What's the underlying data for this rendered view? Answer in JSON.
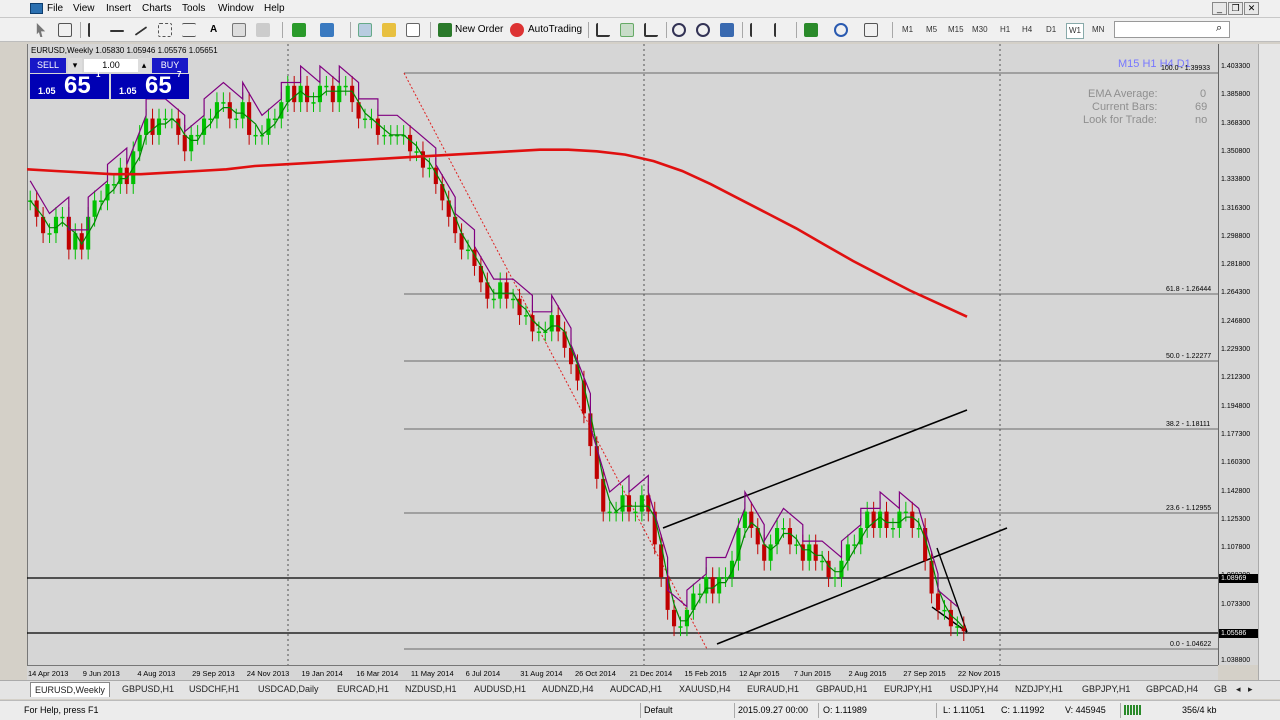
{
  "menu": {
    "items": [
      "File",
      "View",
      "Insert",
      "Charts",
      "Tools",
      "Window",
      "Help"
    ]
  },
  "toolbar": {
    "new_order": "New Order",
    "autotrading": "AutoTrading",
    "timeframes": [
      "M1",
      "M5",
      "M15",
      "M30",
      "H1",
      "H4",
      "D1",
      "W1",
      "MN"
    ],
    "active_timeframe": "W1"
  },
  "chart": {
    "symbol_header": "EURUSD,Weekly 1.05830 1.05946 1.05576 1.05651",
    "trade_panel": {
      "sell_label": "SELL",
      "buy_label": "BUY",
      "lot": "1.00",
      "sell_small": "1.05",
      "sell_big": "65",
      "sell_sup": "1",
      "buy_small": "1.05",
      "buy_big": "65",
      "buy_sup": "7"
    },
    "timeframe_row": "M15 H1 H4 D1",
    "ema_panel": [
      {
        "label": "EMA Average:",
        "value": "0"
      },
      {
        "label": "Current Bars:",
        "value": "69"
      },
      {
        "label": "Look for Trade:",
        "value": "no"
      }
    ],
    "fib_levels": [
      "100.0 - 1.39933",
      "61.8 - 1.26444",
      "50.0 - 1.22277",
      "38.2 - 1.18111",
      "23.6 - 1.12955",
      "0.0 - 1.04622"
    ],
    "price_labels": [
      "1.403300",
      "1.385800",
      "1.368300",
      "1.350800",
      "1.333800",
      "1.316300",
      "1.298800",
      "1.281800",
      "1.264300",
      "1.246800",
      "1.229300",
      "1.212300",
      "1.194800",
      "1.177300",
      "1.160300",
      "1.142800",
      "1.125300",
      "1.107800",
      "1.090300",
      "1.073300",
      "1.055800",
      "1.038800"
    ],
    "price_hline1": "1.08969",
    "price_hline2": "1.05586",
    "time_labels": [
      "14 Apr 2013",
      "9 Jun 2013",
      "4 Aug 2013",
      "29 Sep 2013",
      "24 Nov 2013",
      "19 Jan 2014",
      "16 Mar 2014",
      "11 May 2014",
      "6 Jul 2014",
      "31 Aug 2014",
      "26 Oct 2014",
      "21 Dec 2014",
      "15 Feb 2015",
      "12 Apr 2015",
      "7 Jun 2015",
      "2 Aug 2015",
      "27 Sep 2015",
      "22 Nov 2015"
    ],
    "chart_data": {
      "type": "candlestick",
      "series": [
        {
          "name": "EMA",
          "color": "#e01010"
        },
        {
          "name": "signal",
          "color": "#800080"
        }
      ],
      "ylim": [
        1.0388,
        1.4033
      ],
      "ema": [
        1.339,
        1.338,
        1.337,
        1.336,
        1.336,
        1.337,
        1.338,
        1.339,
        1.341,
        1.342,
        1.343,
        1.344,
        1.345,
        1.346,
        1.347,
        1.348,
        1.349,
        1.35,
        1.351,
        1.351,
        1.35,
        1.348,
        1.344,
        1.338,
        1.33,
        1.321,
        1.312,
        1.303,
        1.293,
        1.283,
        1.274,
        1.265,
        1.257,
        1.249
      ],
      "close": [
        1.32,
        1.31,
        1.3,
        1.3,
        1.31,
        1.31,
        1.29,
        1.3,
        1.29,
        1.31,
        1.32,
        1.32,
        1.33,
        1.33,
        1.34,
        1.33,
        1.35,
        1.36,
        1.37,
        1.36,
        1.37,
        1.37,
        1.37,
        1.36,
        1.35,
        1.36,
        1.36,
        1.37,
        1.37,
        1.38,
        1.38,
        1.37,
        1.37,
        1.38,
        1.36,
        1.36,
        1.36,
        1.37,
        1.37,
        1.38,
        1.39,
        1.38,
        1.39,
        1.38,
        1.38,
        1.39,
        1.39,
        1.38,
        1.39,
        1.39,
        1.38,
        1.37,
        1.37,
        1.37,
        1.36,
        1.36,
        1.36,
        1.36,
        1.36,
        1.35,
        1.35,
        1.34,
        1.34,
        1.33,
        1.32,
        1.31,
        1.3,
        1.29,
        1.29,
        1.28,
        1.27,
        1.26,
        1.26,
        1.27,
        1.26,
        1.26,
        1.25,
        1.25,
        1.24,
        1.24,
        1.24,
        1.25,
        1.24,
        1.23,
        1.22,
        1.21,
        1.19,
        1.17,
        1.15,
        1.13,
        1.13,
        1.13,
        1.14,
        1.13,
        1.13,
        1.14,
        1.13,
        1.11,
        1.09,
        1.07,
        1.06,
        1.06,
        1.07,
        1.08,
        1.08,
        1.09,
        1.08,
        1.09,
        1.09,
        1.1,
        1.12,
        1.13,
        1.12,
        1.11,
        1.1,
        1.11,
        1.12,
        1.12,
        1.11,
        1.11,
        1.1,
        1.11,
        1.1,
        1.1,
        1.09,
        1.09,
        1.1,
        1.11,
        1.11,
        1.12,
        1.13,
        1.12,
        1.13,
        1.12,
        1.12,
        1.13,
        1.13,
        1.12,
        1.12,
        1.1,
        1.08,
        1.07,
        1.07,
        1.06,
        1.06,
        1.057
      ]
    }
  },
  "tabs": [
    "EURUSD,Weekly",
    "GBPUSD,H1",
    "USDCHF,H1",
    "USDCAD,Daily",
    "EURCAD,H1",
    "NZDUSD,H1",
    "AUDUSD,H1",
    "AUDNZD,H4",
    "AUDCAD,H1",
    "XAUUSD,H4",
    "EURAUD,H1",
    "GBPAUD,H1",
    "EURJPY,H1",
    "USDJPY,H4",
    "NZDJPY,H1",
    "GBPJPY,H1",
    "GBPCAD,H4",
    "GB"
  ],
  "status": {
    "help": "For Help, press F1",
    "profile": "Default",
    "time": "2015.09.27 00:00",
    "open": "O: 1.11989",
    "low": "L: 1.11051",
    "close": "C: 1.11992",
    "volume": "V: 445945",
    "conn": "356/4 kb"
  },
  "colors": {
    "ema": "#e01010",
    "signal": "#800080",
    "bull": "#00c000",
    "bear": "#c00000",
    "panel_blue": "#0000b4"
  }
}
